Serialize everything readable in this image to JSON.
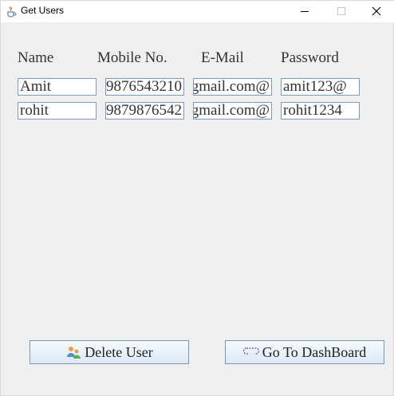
{
  "window": {
    "title": "Get Users"
  },
  "icons": {
    "app": "java-cup-icon",
    "minimize": "minimize-icon",
    "maximize": "maximize-icon",
    "close": "close-icon",
    "delete": "users-icon",
    "dashboard": "dashboard-icon"
  },
  "columns": {
    "name": "Name",
    "mobile": "Mobile No.",
    "email": "E-Mail",
    "password": "Password"
  },
  "rows": [
    {
      "name": "Amit",
      "mobile": "9876543210",
      "email": "@gmail.com",
      "password": "amit123@"
    },
    {
      "name": "rohit",
      "mobile": "9879876542",
      "email": "@gmail.com",
      "password": "rohit1234"
    }
  ],
  "buttons": {
    "delete": "Delete User",
    "dashboard": "Go To DashBoard"
  }
}
